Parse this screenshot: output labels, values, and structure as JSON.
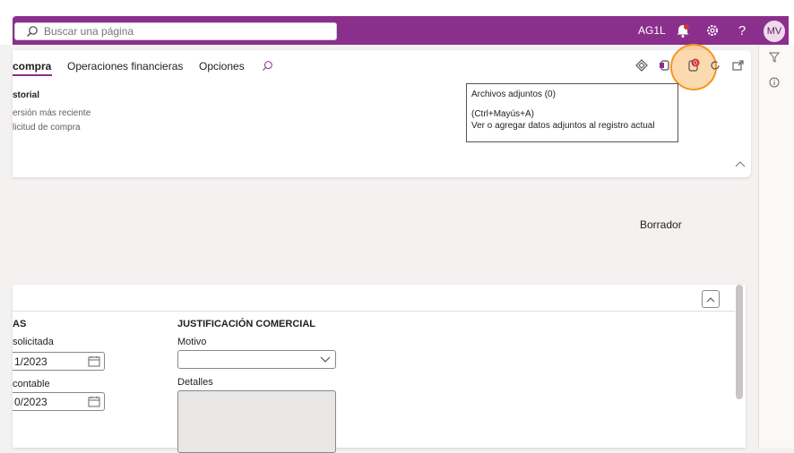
{
  "search": {
    "placeholder": "Buscar una página"
  },
  "topbar": {
    "company": "AG1L",
    "avatar": "MV",
    "help_label": "?"
  },
  "tabs": [
    {
      "label": "compra"
    },
    {
      "label": "Operaciones financieras"
    },
    {
      "label": "Opciones"
    }
  ],
  "actions": {
    "attachments_count": "0"
  },
  "tooltip": {
    "title": "Archivos adjuntos (0)",
    "shortcut": "(Ctrl+Mayús+A)",
    "description": "Ver o agregar datos adjuntos al registro actual"
  },
  "history": {
    "title": "storial",
    "lines": [
      "ersión más reciente",
      "licitud de compra"
    ]
  },
  "status": "Borrador",
  "sections": {
    "left": {
      "title": "AS",
      "fields": [
        {
          "label": "solicitada",
          "value": "1/2023"
        },
        {
          "label": "contable",
          "value": "0/2023"
        }
      ]
    },
    "justification": {
      "title": "JUSTIFICACIÓN COMERCIAL",
      "reason_label": "Motivo",
      "reason_value": "",
      "details_label": "Detalles"
    }
  },
  "colors": {
    "brand": "#8b2f8c",
    "highlight": "#f7941d",
    "badge": "#d13438"
  }
}
